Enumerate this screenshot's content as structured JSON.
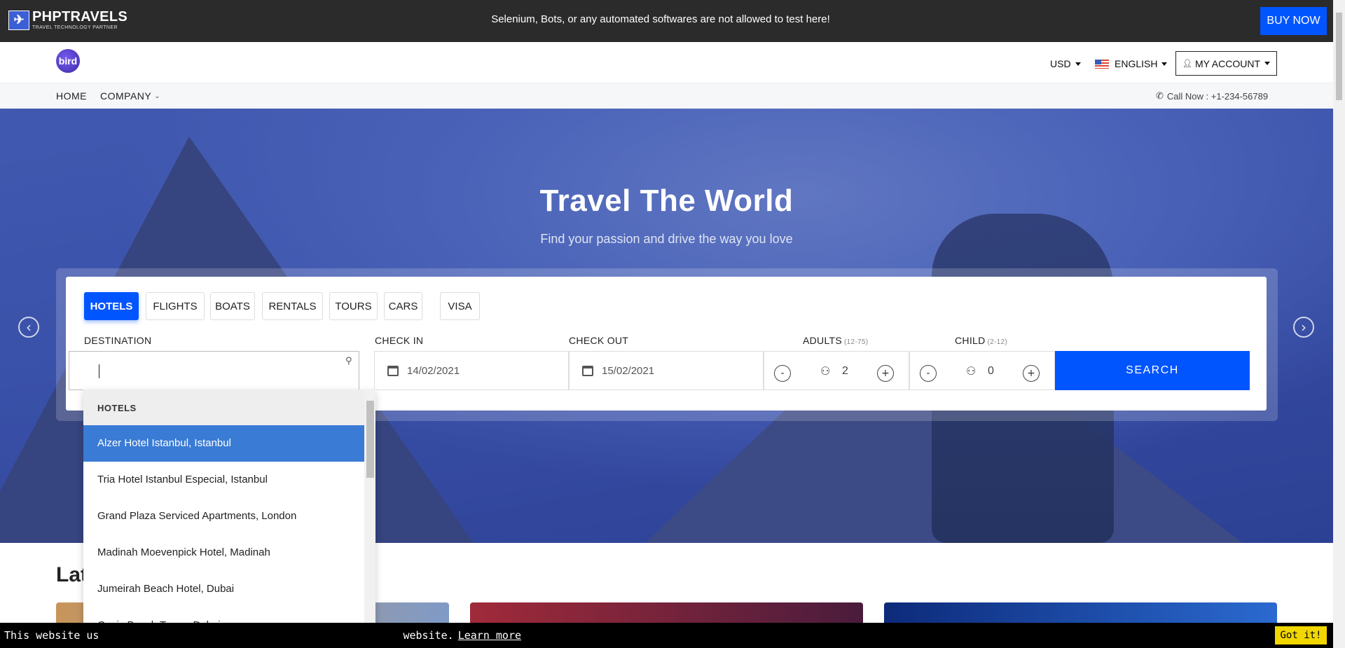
{
  "topbar": {
    "brand_mark": "✈",
    "brand_name": "PHPTRAVELS",
    "brand_tagline": "TRAVEL TECHNOLOGY PARTNER",
    "notice": "Selenium, Bots, or any automated softwares are not allowed to test here!",
    "buy_now": "BUY NOW"
  },
  "header": {
    "logo_text": "bird",
    "currency": "USD",
    "language": "ENGLISH",
    "account": "MY ACCOUNT"
  },
  "nav": {
    "home": "HOME",
    "company": "COMPANY",
    "call": "Call Now : +1-234-56789"
  },
  "hero": {
    "title": "Travel The World",
    "subtitle": "Find your passion and drive the way you love",
    "prev_arrow": "‹",
    "next_arrow": "›"
  },
  "search": {
    "tabs": [
      "HOTELS",
      "FLIGHTS",
      "BOATS",
      "RENTALS",
      "TOURS",
      "CARS",
      "VISA"
    ],
    "active_tab": "HOTELS",
    "destination_label": "DESTINATION",
    "destination_value": "",
    "checkin_label": "CHECK IN",
    "checkin_value": "14/02/2021",
    "checkout_label": "CHECK OUT",
    "checkout_value": "15/02/2021",
    "adults_label": "ADULTS",
    "adults_range": "(12-75)",
    "adults_value": "2",
    "child_label": "CHILD",
    "child_range": "(2-12)",
    "child_value": "0",
    "minus": "-",
    "plus": "+",
    "search_button": "SEARCH"
  },
  "dropdown": {
    "header": "HOTELS",
    "items": [
      "Alzer Hotel Istanbul, Istanbul",
      "Tria Hotel Istanbul Especial, Istanbul",
      "Grand Plaza Serviced Apartments, London",
      "Madinah Moevenpick Hotel, Madinah",
      "Jumeirah Beach Hotel, Dubai",
      "Oasis Beach Tower, Dubai"
    ],
    "selected_index": 0
  },
  "latest": {
    "heading_visible": "Lat"
  },
  "cookie": {
    "text_left": "This website us",
    "text_right": "website.",
    "link": "Learn more",
    "button": "Got it!"
  },
  "colors": {
    "primary": "#0055ff",
    "selected": "#3a7bd5",
    "topbar": "#2b2b2b",
    "cookie_button": "#f1d600"
  }
}
